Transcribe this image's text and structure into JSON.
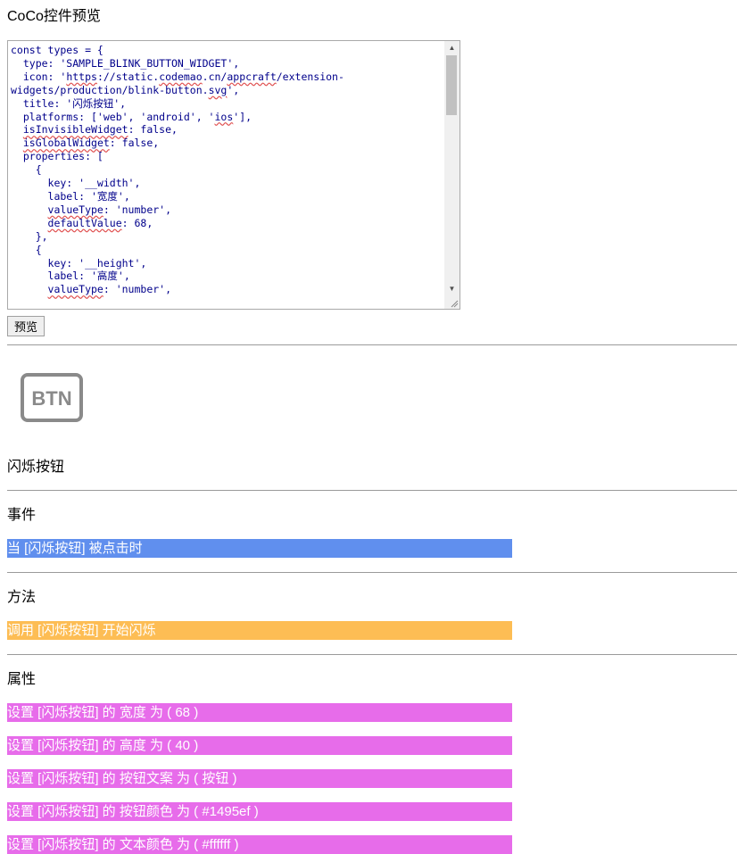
{
  "page": {
    "title": "CoCo控件预览",
    "preview_button": "预览",
    "widget_icon_text": "BTN",
    "widget_name": "闪烁按钮",
    "colors": {
      "event": "#608fee",
      "method": "#fdbd54",
      "property": "#e76cea"
    }
  },
  "editor": {
    "lines": [
      "const types = {",
      "  type: 'SAMPLE_BLINK_BUTTON_WIDGET',",
      "  icon: 'https://static.codemao.cn/appcraft/extension-",
      "widgets/production/blink-button.svg',",
      "  title: '闪烁按钮',",
      "  platforms: ['web', 'android', 'ios'],",
      "  isInvisibleWidget: false,",
      "  isGlobalWidget: false,",
      "  properties: [",
      "    {",
      "      key: '__width',",
      "      label: '宽度',",
      "      valueType: 'number',",
      "      defaultValue: 68,",
      "    },",
      "    {",
      "      key: '__height',",
      "      label: '高度',",
      "      valueType: 'number',"
    ]
  },
  "sections": {
    "events": {
      "label": "事件",
      "blocks": [
        "当 [闪烁按钮] 被点击时"
      ]
    },
    "methods": {
      "label": "方法",
      "blocks": [
        "调用 [闪烁按钮] 开始闪烁"
      ]
    },
    "properties": {
      "label": "属性",
      "blocks": [
        "设置 [闪烁按钮] 的 宽度 为 ( 68 )",
        "设置 [闪烁按钮] 的 高度 为 ( 40 )",
        "设置 [闪烁按钮] 的 按钮文案 为 ( 按钮 )",
        "设置 [闪烁按钮] 的 按钮颜色 为 ( #1495ef )",
        "设置 [闪烁按钮] 的 文本颜色 为 ( #ffffff )"
      ]
    }
  }
}
